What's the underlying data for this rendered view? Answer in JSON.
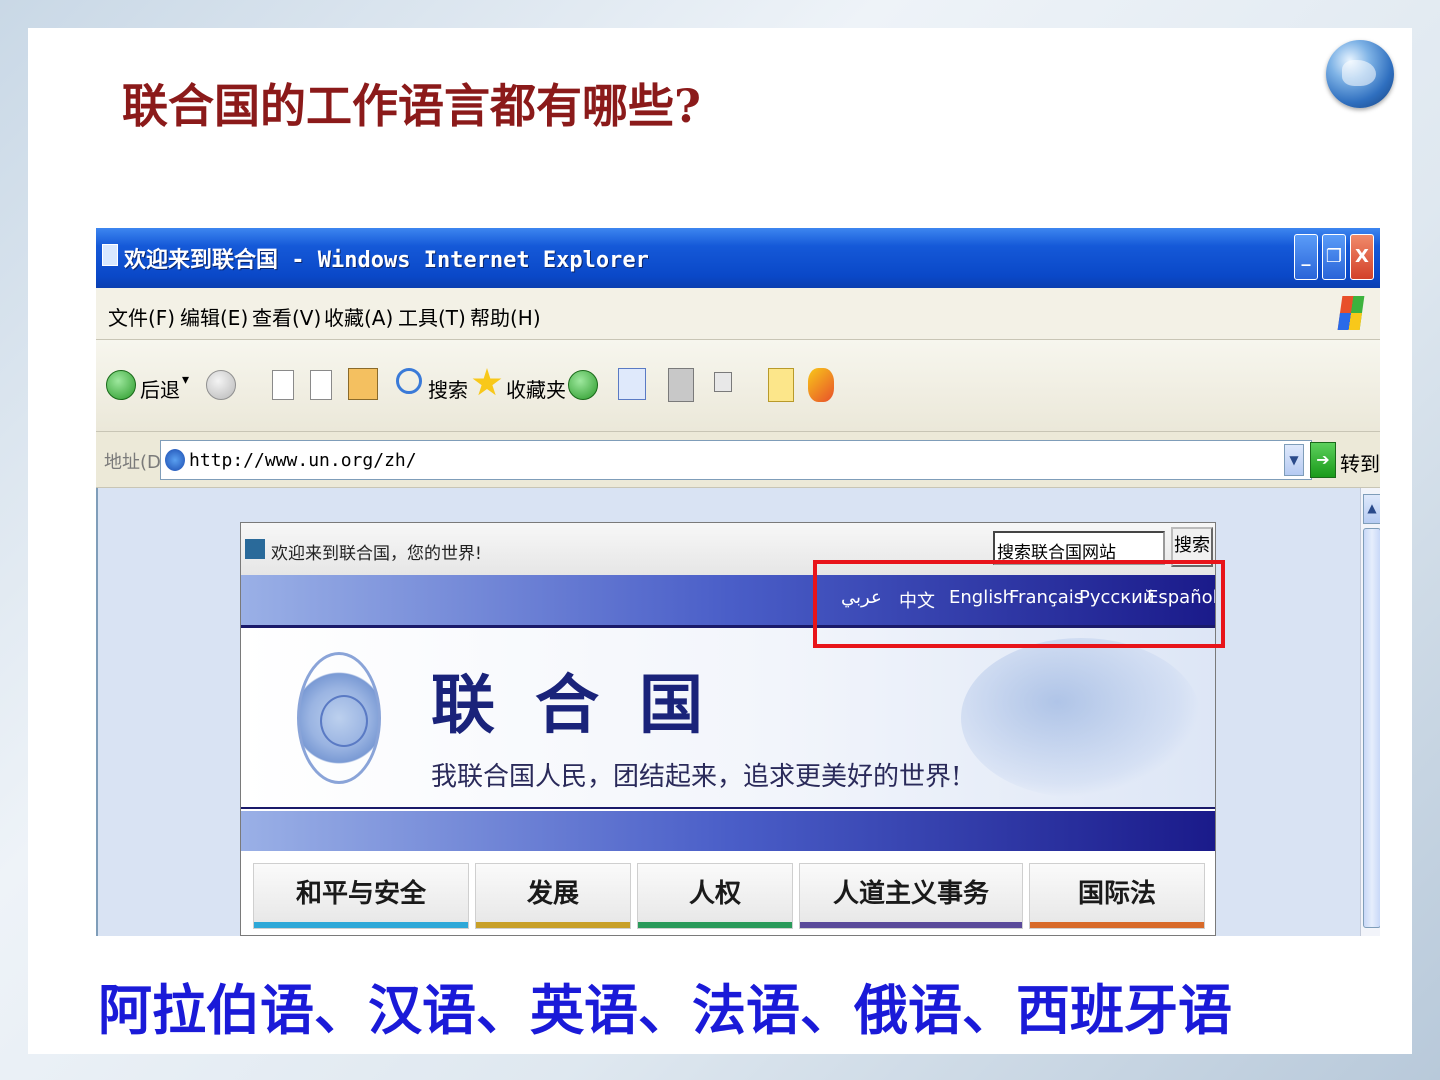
{
  "slide": {
    "title": "联合国的工作语言都有哪些?",
    "caption": "阿拉伯语、汉语、英语、法语、俄语、西班牙语"
  },
  "browser": {
    "window_title": "欢迎来到联合国 - Windows Internet Explorer",
    "window_buttons": {
      "minimize": "_",
      "restore": "❐",
      "close": "X"
    },
    "menu": [
      "文件(F)",
      "编辑(E)",
      "查看(V)",
      "收藏(A)",
      "工具(T)",
      "帮助(H)"
    ],
    "toolbar": {
      "back": "后退",
      "search": "搜索",
      "favorites": "收藏夹"
    },
    "address": {
      "label": "地址(D)",
      "url": "http://www.un.org/zh/",
      "go": "转到"
    }
  },
  "un_page": {
    "welcome": "欢迎来到联合国，您的世界!",
    "search_placeholder": "搜索联合国网站",
    "search_button": "搜索",
    "languages": [
      "عربي",
      "中文",
      "English",
      "Français",
      "Русский",
      "Español"
    ],
    "org_name": "联合国",
    "motto": "我联合国人民，团结起来，追求更美好的世界!",
    "nav": [
      {
        "label": "和平与安全",
        "color": "#2ea8d8"
      },
      {
        "label": "发展",
        "color": "#c8a028"
      },
      {
        "label": "人权",
        "color": "#2a9a5a"
      },
      {
        "label": "人道主义事务",
        "color": "#5a4a9a"
      },
      {
        "label": "国际法",
        "color": "#d86a2a"
      }
    ]
  }
}
